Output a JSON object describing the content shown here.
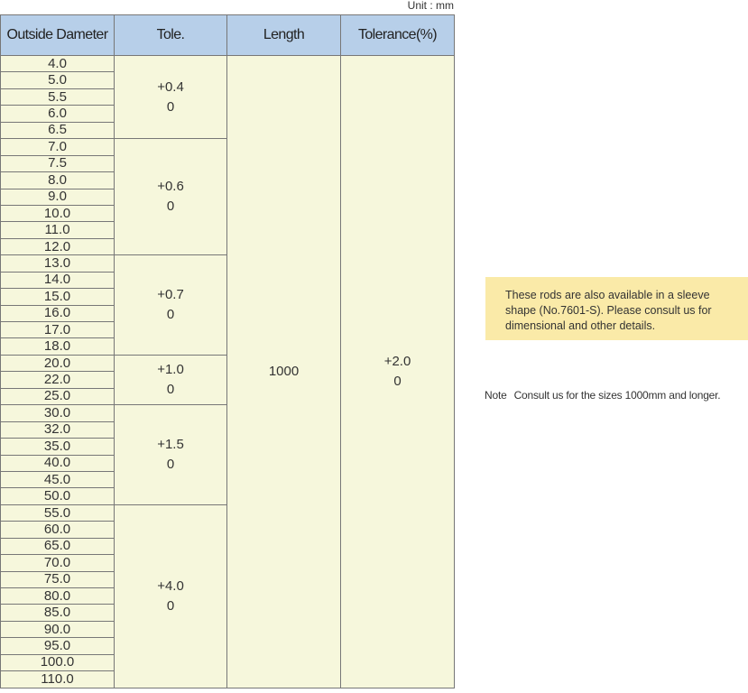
{
  "unit_label": "Unit : mm",
  "table": {
    "headers": {
      "outside_diameter": "Outside Dameter",
      "tolerance": "Tole.",
      "length": "Length",
      "length_tolerance": "Tolerance(%)"
    },
    "diameters": [
      "4.0",
      "5.0",
      "5.5",
      "6.0",
      "6.5",
      "7.0",
      "7.5",
      "8.0",
      "9.0",
      "10.0",
      "11.0",
      "12.0",
      "13.0",
      "14.0",
      "15.0",
      "16.0",
      "17.0",
      "18.0",
      "20.0",
      "22.0",
      "25.0",
      "30.0",
      "32.0",
      "35.0",
      "40.0",
      "45.0",
      "50.0",
      "55.0",
      "60.0",
      "65.0",
      "70.0",
      "75.0",
      "80.0",
      "85.0",
      "90.0",
      "95.0",
      "100.0",
      "110.0"
    ],
    "tolerance_groups": [
      {
        "span": 5,
        "upper": "+0.4",
        "lower": "0"
      },
      {
        "span": 7,
        "upper": "+0.6",
        "lower": "0"
      },
      {
        "span": 6,
        "upper": "+0.7",
        "lower": "0"
      },
      {
        "span": 3,
        "upper": "+1.0",
        "lower": "0"
      },
      {
        "span": 6,
        "upper": "+1.5",
        "lower": "0"
      },
      {
        "span": 11,
        "upper": "+4.0",
        "lower": "0"
      }
    ],
    "length": "1000",
    "length_tolerance_upper": "+2.0",
    "length_tolerance_lower": "0"
  },
  "notes": {
    "sleeve_info": "These rods are also available in a sleeve shape (No.7601-S). Please consult us for dimensional and other details.",
    "note_label": "Note",
    "note_text": "Consult us for the sizes 1000mm and longer."
  },
  "colors": {
    "header_bg": "#b7cfe9",
    "cell_bg": "#f6f7dc",
    "note_bg": "#faeaa8",
    "border": "#777777"
  }
}
